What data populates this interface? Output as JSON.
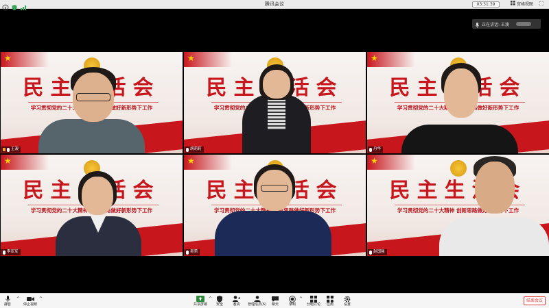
{
  "window": {
    "title": "腾讯会议",
    "time": "03:31:39",
    "view_label": "宫格视图"
  },
  "speaking": {
    "label": "正在讲话: 王澳"
  },
  "banner": {
    "title": "民主生活会",
    "subtitle": "学习贯彻党的二十大精神 创新思路做好新形势下工作"
  },
  "participants": [
    {
      "name": "王澳"
    },
    {
      "name": "胡莉莉"
    },
    {
      "name": "丹华"
    },
    {
      "name": "李亚军"
    },
    {
      "name": "吴莉"
    },
    {
      "name": "赵国强"
    }
  ],
  "toolbar": {
    "mute": "静音",
    "stop_video": "停止视频",
    "share": "共享屏幕",
    "security": "安全",
    "invite": "邀请",
    "manage": "管理成员(6)",
    "chat": "聊天",
    "record": "录制",
    "breakout": "分组讨论",
    "apps": "应用",
    "settings": "设置",
    "leave": "结束会议"
  }
}
